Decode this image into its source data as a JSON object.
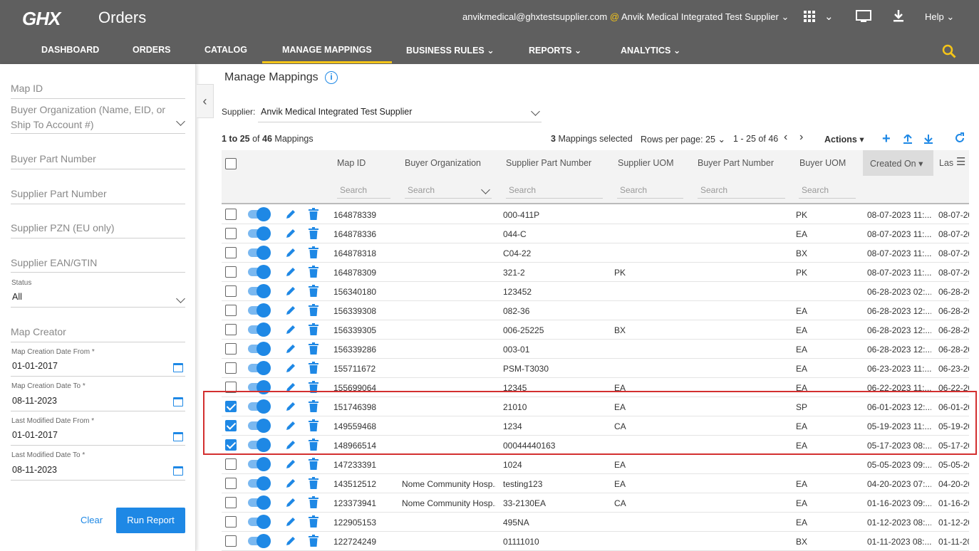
{
  "app": {
    "logo": "GHX",
    "title": "Orders"
  },
  "user": {
    "email": "anvikmedical@ghxtestsupplier.com",
    "at": "@",
    "org": "Anvik Medical Integrated Test Supplier",
    "help": "Help"
  },
  "nav": [
    "DASHBOARD",
    "ORDERS",
    "CATALOG",
    "MANAGE MAPPINGS",
    "BUSINESS RULES",
    "REPORTS",
    "ANALYTICS"
  ],
  "filters": {
    "map_id": "Map ID",
    "buyer_org_line1": "Buyer Organization (Name, EID, or",
    "buyer_org_line2": "Ship To Account #)",
    "buyer_part": "Buyer Part Number",
    "supplier_part": "Supplier Part Number",
    "pzn": "Supplier PZN (EU only)",
    "ean": "Supplier EAN/GTIN",
    "status_label": "Status",
    "status_value": "All",
    "map_creator": "Map Creator",
    "creation_from_label": "Map Creation Date From *",
    "creation_from": "01-01-2017",
    "creation_to_label": "Map Creation Date To *",
    "creation_to": "08-11-2023",
    "modified_from_label": "Last Modified Date From *",
    "modified_from": "01-01-2017",
    "modified_to_label": "Last Modified Date To *",
    "modified_to": "08-11-2023",
    "clear": "Clear",
    "run": "Run Report"
  },
  "main": {
    "title": "Manage Mappings",
    "supplier_label": "Supplier:",
    "supplier_value": "Anvik Medical Integrated Test Supplier",
    "count_range": "1 to 25",
    "count_of": "of",
    "count_total": "46",
    "count_suffix": "Mappings",
    "selected_count": "3",
    "selected_text": "Mappings selected",
    "rows_per_page_label": "Rows per page:",
    "rows_per_page": "25",
    "page_range": "1 - 25 of 46",
    "actions": "Actions"
  },
  "columns": [
    "Map ID",
    "Buyer Organization",
    "Supplier Part Number",
    "Supplier UOM",
    "Buyer Part Number",
    "Buyer UOM",
    "Created On",
    "Las"
  ],
  "search_placeholder": "Search",
  "rows": [
    {
      "id": "164878339",
      "org": "",
      "spn": "000-411P",
      "suom": "",
      "bpn": "",
      "buom": "PK",
      "created": "08-07-2023 11:...",
      "last": "08-07-20",
      "checked": false
    },
    {
      "id": "164878336",
      "org": "",
      "spn": "044-C",
      "suom": "",
      "bpn": "",
      "buom": "EA",
      "created": "08-07-2023 11:...",
      "last": "08-07-20",
      "checked": false
    },
    {
      "id": "164878318",
      "org": "",
      "spn": "C04-22",
      "suom": "",
      "bpn": "",
      "buom": "BX",
      "created": "08-07-2023 11:...",
      "last": "08-07-20",
      "checked": false
    },
    {
      "id": "164878309",
      "org": "",
      "spn": "321-2",
      "suom": "PK",
      "bpn": "",
      "buom": "PK",
      "created": "08-07-2023 11:...",
      "last": "08-07-20",
      "checked": false
    },
    {
      "id": "156340180",
      "org": "",
      "spn": "123452",
      "suom": "",
      "bpn": "",
      "buom": "",
      "created": "06-28-2023 02:...",
      "last": "06-28-20",
      "checked": false
    },
    {
      "id": "156339308",
      "org": "",
      "spn": "082-36",
      "suom": "",
      "bpn": "",
      "buom": "EA",
      "created": "06-28-2023 12:...",
      "last": "06-28-20",
      "checked": false
    },
    {
      "id": "156339305",
      "org": "",
      "spn": "006-25225",
      "suom": "BX",
      "bpn": "",
      "buom": "EA",
      "created": "06-28-2023 12:...",
      "last": "06-28-20",
      "checked": false
    },
    {
      "id": "156339286",
      "org": "",
      "spn": "003-01",
      "suom": "",
      "bpn": "",
      "buom": "EA",
      "created": "06-28-2023 12:...",
      "last": "06-28-20",
      "checked": false
    },
    {
      "id": "155711672",
      "org": "",
      "spn": "PSM-T3030",
      "suom": "",
      "bpn": "",
      "buom": "EA",
      "created": "06-23-2023 11:...",
      "last": "06-23-20",
      "checked": false
    },
    {
      "id": "155699064",
      "org": "",
      "spn": "12345",
      "suom": "EA",
      "bpn": "",
      "buom": "EA",
      "created": "06-22-2023 11:...",
      "last": "06-22-20",
      "checked": false
    },
    {
      "id": "151746398",
      "org": "",
      "spn": "21010",
      "suom": "EA",
      "bpn": "",
      "buom": "SP",
      "created": "06-01-2023 12:...",
      "last": "06-01-20",
      "checked": true
    },
    {
      "id": "149559468",
      "org": "",
      "spn": "1234",
      "suom": "CA",
      "bpn": "",
      "buom": "EA",
      "created": "05-19-2023 11:...",
      "last": "05-19-20",
      "checked": true
    },
    {
      "id": "148966514",
      "org": "",
      "spn": "00044440163",
      "suom": "",
      "bpn": "",
      "buom": "EA",
      "created": "05-17-2023 08:...",
      "last": "05-17-20",
      "checked": true
    },
    {
      "id": "147233391",
      "org": "",
      "spn": "1024",
      "suom": "EA",
      "bpn": "",
      "buom": "",
      "created": "05-05-2023 09:...",
      "last": "05-05-20",
      "checked": false
    },
    {
      "id": "143512512",
      "org": "Nome Community Hosp...",
      "spn": "testing123",
      "suom": "EA",
      "bpn": "",
      "buom": "EA",
      "created": "04-20-2023 07:...",
      "last": "04-20-20",
      "checked": false
    },
    {
      "id": "123373941",
      "org": "Nome Community Hosp...",
      "spn": "33-2130EA",
      "suom": "CA",
      "bpn": "",
      "buom": "EA",
      "created": "01-16-2023 09:...",
      "last": "01-16-20",
      "checked": false
    },
    {
      "id": "122905153",
      "org": "",
      "spn": "495NA",
      "suom": "",
      "bpn": "",
      "buom": "EA",
      "created": "01-12-2023 08:...",
      "last": "01-12-20",
      "checked": false
    },
    {
      "id": "122724249",
      "org": "",
      "spn": "01111010",
      "suom": "",
      "bpn": "",
      "buom": "BX",
      "created": "01-11-2023 08:...",
      "last": "01-11-20",
      "checked": false
    }
  ],
  "colors": {
    "topbar": "#5f5f5f",
    "accent": "#1e88e5",
    "active_underline": "#f5c518",
    "highlight": "#d32f2f"
  }
}
